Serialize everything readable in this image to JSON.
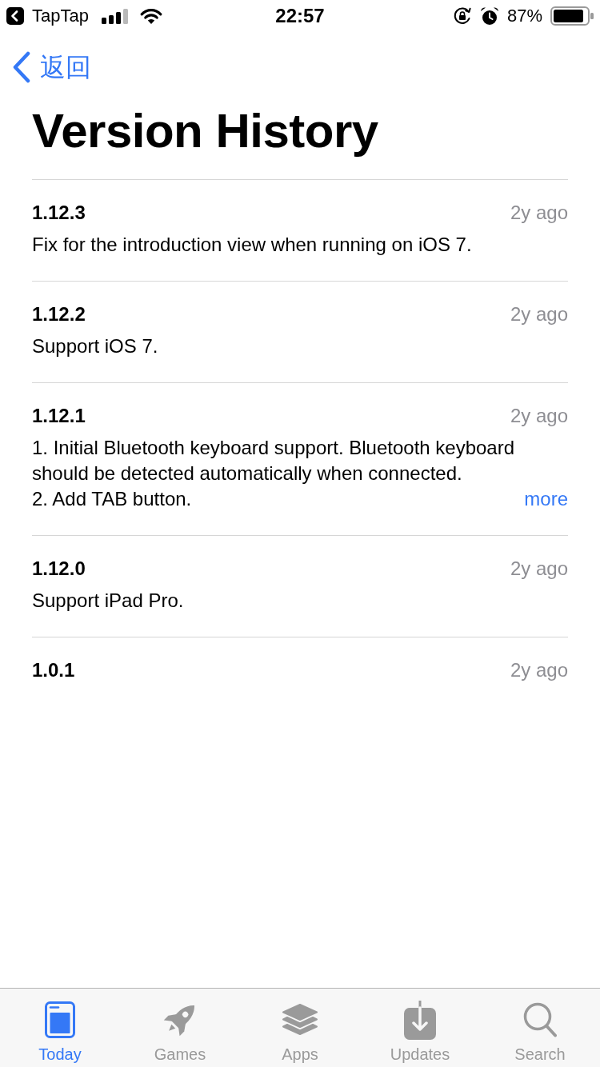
{
  "status_bar": {
    "back_app": "TapTap",
    "time": "22:57",
    "battery_percent": "87%"
  },
  "nav": {
    "back_label": "返回"
  },
  "title": "Version History",
  "versions": [
    {
      "version": "1.12.3",
      "date": "2y ago",
      "notes": [
        "Fix for the introduction view when running on iOS 7."
      ]
    },
    {
      "version": "1.12.2",
      "date": "2y ago",
      "notes": [
        "Support iOS 7."
      ]
    },
    {
      "version": "1.12.1",
      "date": "2y ago",
      "notes": [
        "1. Initial Bluetooth keyboard support. Bluetooth keyboard should be detected automatically when connected.",
        "2. Add TAB button."
      ],
      "more_link": "more"
    },
    {
      "version": "1.12.0",
      "date": "2y ago",
      "notes": [
        "Support iPad Pro."
      ]
    },
    {
      "version": "1.0.1",
      "date": "2y ago"
    }
  ],
  "tabs": [
    {
      "label": "Today",
      "selected": true
    },
    {
      "label": "Games",
      "selected": false
    },
    {
      "label": "Apps",
      "selected": false
    },
    {
      "label": "Updates",
      "selected": false
    },
    {
      "label": "Search",
      "selected": false
    }
  ]
}
